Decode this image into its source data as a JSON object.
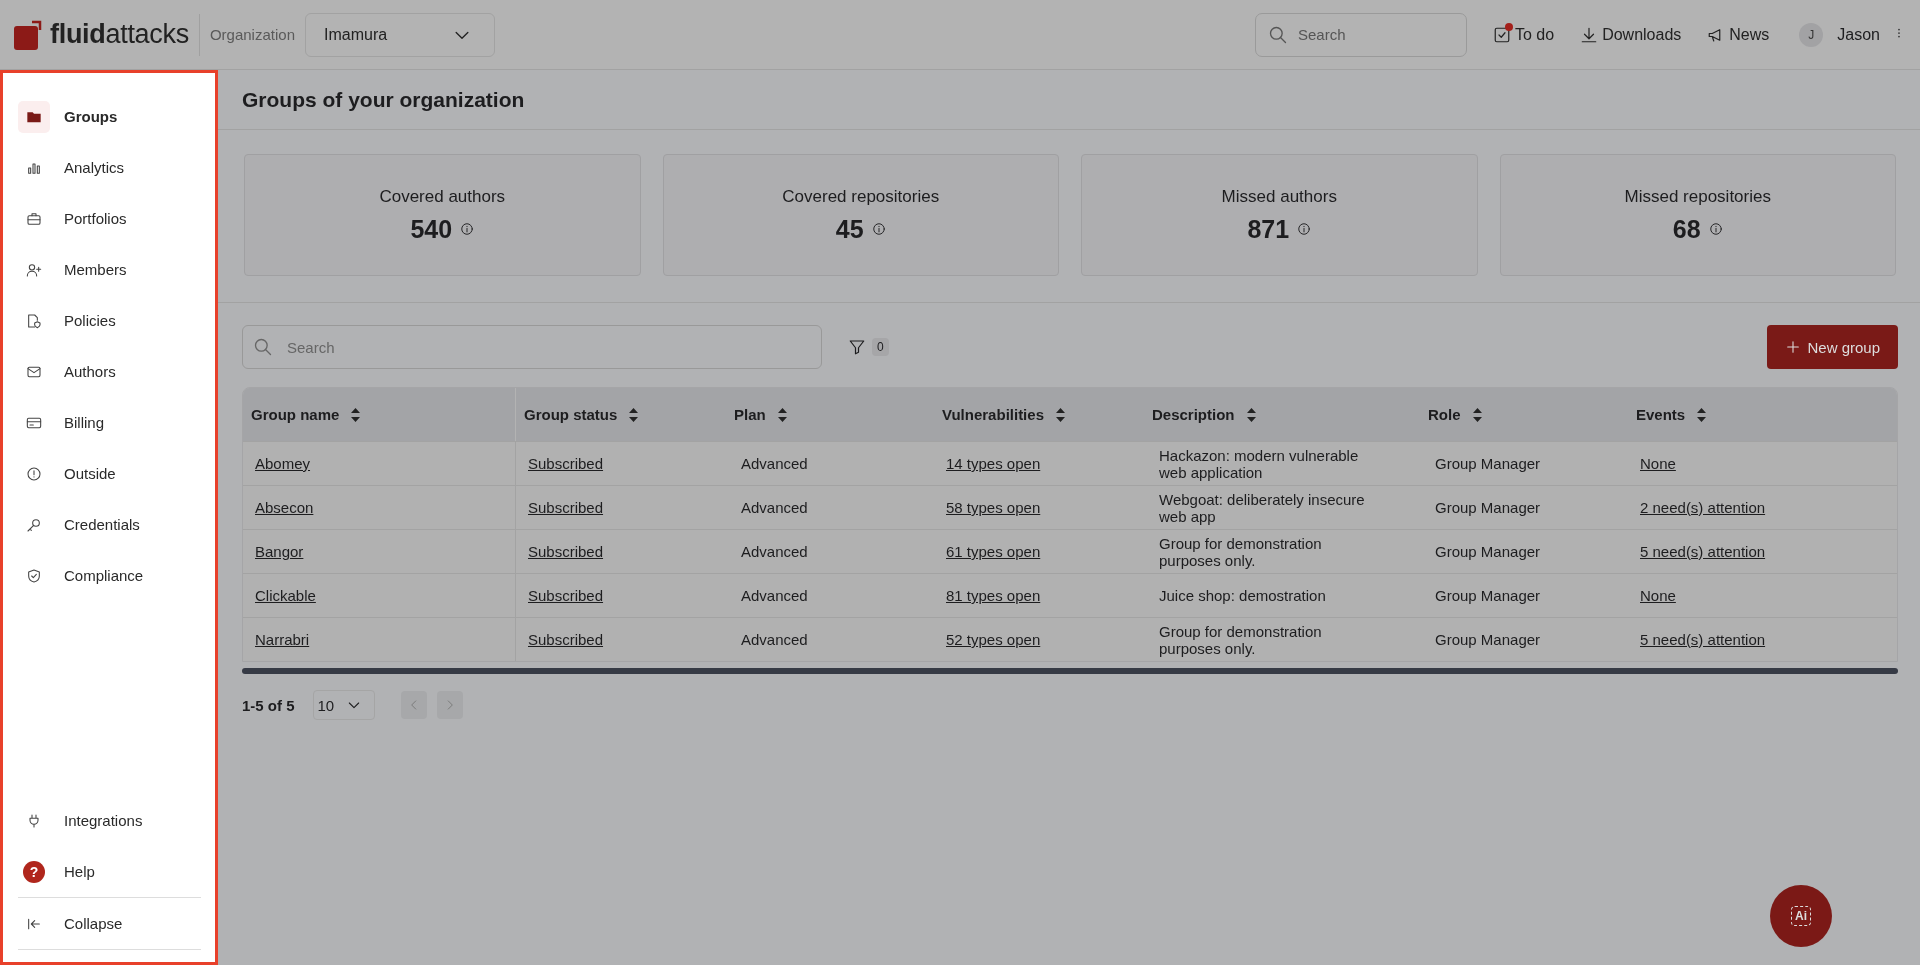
{
  "header": {
    "logo": "**fluid**attacks",
    "org_label": "Organization",
    "org_select": "Imamura",
    "search_placeholder": "Search",
    "actions": [
      {
        "label": "To do",
        "notification": true
      },
      {
        "label": "Downloads",
        "notification": false
      },
      {
        "label": "News",
        "notification": false
      }
    ],
    "user": {
      "initial": "J",
      "name": "Jason"
    }
  },
  "sidebar": {
    "items": [
      {
        "label": "Groups",
        "selected": true
      },
      {
        "label": "Analytics",
        "selected": false
      },
      {
        "label": "Portfolios",
        "selected": false
      },
      {
        "label": "Members",
        "selected": false
      },
      {
        "label": "Policies",
        "selected": false
      },
      {
        "label": "Authors",
        "selected": false
      },
      {
        "label": "Billing",
        "selected": false
      },
      {
        "label": "Outside",
        "selected": false
      },
      {
        "label": "Credentials",
        "selected": false
      },
      {
        "label": "Compliance",
        "selected": false
      }
    ],
    "bottom_items": [
      {
        "label": "Integrations",
        "kind": "plain"
      },
      {
        "label": "Help",
        "kind": "badge",
        "glyph": "?"
      }
    ],
    "collapse": "Collapse"
  },
  "page": {
    "title": "Groups of your organization"
  },
  "stats": [
    {
      "label": "Covered authors",
      "value": "540"
    },
    {
      "label": "Covered repositories",
      "value": "45"
    },
    {
      "label": "Missed authors",
      "value": "871"
    },
    {
      "label": "Missed repositories",
      "value": "68"
    }
  ],
  "toolbar": {
    "search_placeholder": "Search",
    "filter_count": "0",
    "new_button": "New group"
  },
  "table": {
    "columns": [
      {
        "label": "Group name",
        "kind": "link"
      },
      {
        "label": "Group status",
        "kind": "link"
      },
      {
        "label": "Plan",
        "kind": "text"
      },
      {
        "label": "Vulnerabilities",
        "kind": "link"
      },
      {
        "label": "Description",
        "kind": "text"
      },
      {
        "label": "Role",
        "kind": "text"
      },
      {
        "label": "Events",
        "kind": "link"
      }
    ],
    "rows": [
      [
        "Abomey",
        "Subscribed",
        "Advanced",
        "14 types open",
        "Hackazon: modern vulnerable web application",
        "Group Manager",
        "None"
      ],
      [
        "Absecon",
        "Subscribed",
        "Advanced",
        "58 types open",
        "Webgoat: deliberately insecure web app",
        "Group Manager",
        "2 need(s) attention"
      ],
      [
        "Bangor",
        "Subscribed",
        "Advanced",
        "61 types open",
        "Group for demonstration purposes only.",
        "Group Manager",
        "5 need(s) attention"
      ],
      [
        "Clickable",
        "Subscribed",
        "Advanced",
        "81 types open",
        "Juice shop: demostration",
        "Group Manager",
        "None"
      ],
      [
        "Narrabri",
        "Subscribed",
        "Advanced",
        "52 types open",
        "Group for demonstration purposes only.",
        "Group Manager",
        "5 need(s) attention"
      ]
    ]
  },
  "pagination": {
    "range": "1-5 of 5",
    "page_size": "10"
  },
  "assistant": {
    "label": "Ai"
  }
}
